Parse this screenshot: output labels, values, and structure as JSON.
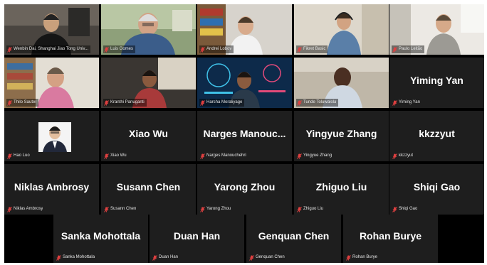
{
  "gallery": {
    "tiles": [
      {
        "name": "Wenbin Dai, Shanghai Jiao Tong Univ...",
        "video": true
      },
      {
        "name": "Luis Gomes",
        "video": true
      },
      {
        "name": "Andrei Lobov",
        "video": true
      },
      {
        "name": "Fikret Basic",
        "video": true
      },
      {
        "name": "Paulo Leitão",
        "video": true
      },
      {
        "name": "Thilo Sauter",
        "video": true
      },
      {
        "name": "Kranthi Panuganti",
        "video": true
      },
      {
        "name": "Harsha Moraliyage",
        "video": true
      },
      {
        "name": "Tunde Toluwalola",
        "video": true
      },
      {
        "name": "Yiming Yan",
        "display": "Yiming Yan",
        "video": false
      },
      {
        "name": "Hao Luo",
        "video": false,
        "photo": true
      },
      {
        "name": "Xiao Wu",
        "display": "Xiao Wu",
        "video": false
      },
      {
        "name": "Narges Manouchehri",
        "display": "Narges Manouc...",
        "video": false
      },
      {
        "name": "Yingyue Zhang",
        "display": "Yingyue Zhang",
        "video": false
      },
      {
        "name": "kkzzyut",
        "display": "kkzzyut",
        "video": false
      },
      {
        "name": "Niklas Ambrosy",
        "display": "Niklas Ambrosy",
        "video": false
      },
      {
        "name": "Susann Chen",
        "display": "Susann Chen",
        "video": false
      },
      {
        "name": "Yarong Zhou",
        "display": "Yarong Zhou",
        "video": false
      },
      {
        "name": "Zhiguo Liu",
        "display": "Zhiguo Liu",
        "video": false
      },
      {
        "name": "Shiqi Gao",
        "display": "Shiqi Gao",
        "video": false
      },
      {
        "name": "Sanka Mohottala",
        "display": "Sanka Mohottala",
        "video": false
      },
      {
        "name": "Duan Han",
        "display": "Duan Han",
        "video": false
      },
      {
        "name": "Genquan Chen",
        "display": "Genquan Chen",
        "video": false
      },
      {
        "name": "Rohan Burye",
        "display": "Rohan Burye",
        "video": false
      }
    ]
  },
  "colors": {
    "mic_muted": "#e04040",
    "active_speaker_border": "#c9d65a",
    "tile_bg": "#1e1e1e"
  }
}
